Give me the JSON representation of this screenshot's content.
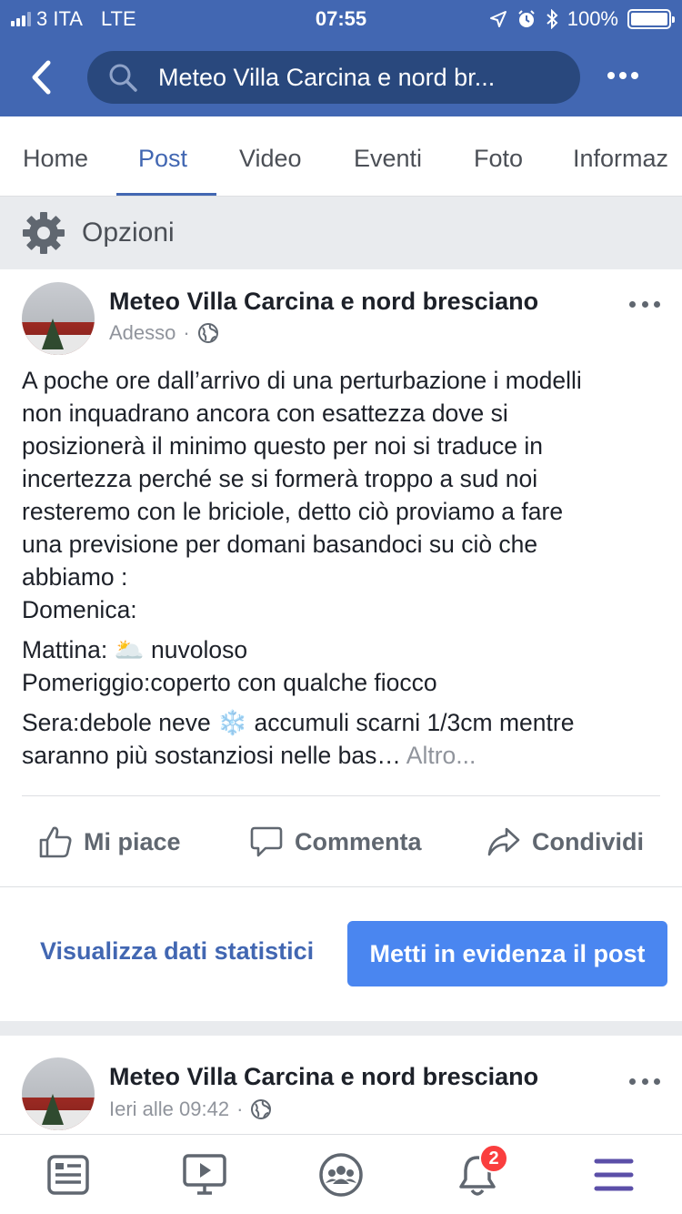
{
  "status_bar": {
    "carrier": "3 ITA",
    "network": "LTE",
    "time": "07:55",
    "battery": "100%"
  },
  "nav": {
    "search_text": "Meteo Villa Carcina e nord br..."
  },
  "tabs": [
    {
      "label": "Home"
    },
    {
      "label": "Post",
      "active": true
    },
    {
      "label": "Video"
    },
    {
      "label": "Eventi"
    },
    {
      "label": "Foto"
    },
    {
      "label": "Informaz"
    }
  ],
  "options": {
    "label": "Opzioni"
  },
  "post": {
    "author": "Meteo Villa Carcina e nord bresciano",
    "time": "Adesso",
    "text_lines": [
      "A poche ore dall’arrivo di una perturbazione i modelli",
      "non inquadrano ancora con esattezza dove si",
      "posizionerà il minimo questo per noi si traduce in",
      "incertezza perché se si formerà troppo a sud noi",
      "resteremo con le briciole, detto ciò proviamo a fare",
      "una previsione per domani basandoci su ciò che",
      "abbiamo :",
      "Domenica:"
    ],
    "mattina": "Mattina: 🌥️ nuvoloso",
    "pomeriggio": "Pomeriggio:coperto con qualche fiocco",
    "sera_line1": "Sera:debole neve ❄️ accumuli scarni 1/3cm mentre",
    "sera_line2": "saranno più sostanziosi nelle bas…",
    "more": "Altro...",
    "actions": {
      "like": "Mi piace",
      "comment": "Commenta",
      "share": "Condividi"
    },
    "stats_link": "Visualizza dati statistici",
    "promote": "Metti in evidenza il post"
  },
  "post2": {
    "author": "Meteo Villa Carcina e nord bresciano",
    "time": "Ieri alle 09:42"
  },
  "bottom_bar": {
    "notifications_count": "2"
  },
  "colors": {
    "brand": "#4267b2",
    "button": "#4a86f0",
    "badge": "#fa3e3e"
  }
}
